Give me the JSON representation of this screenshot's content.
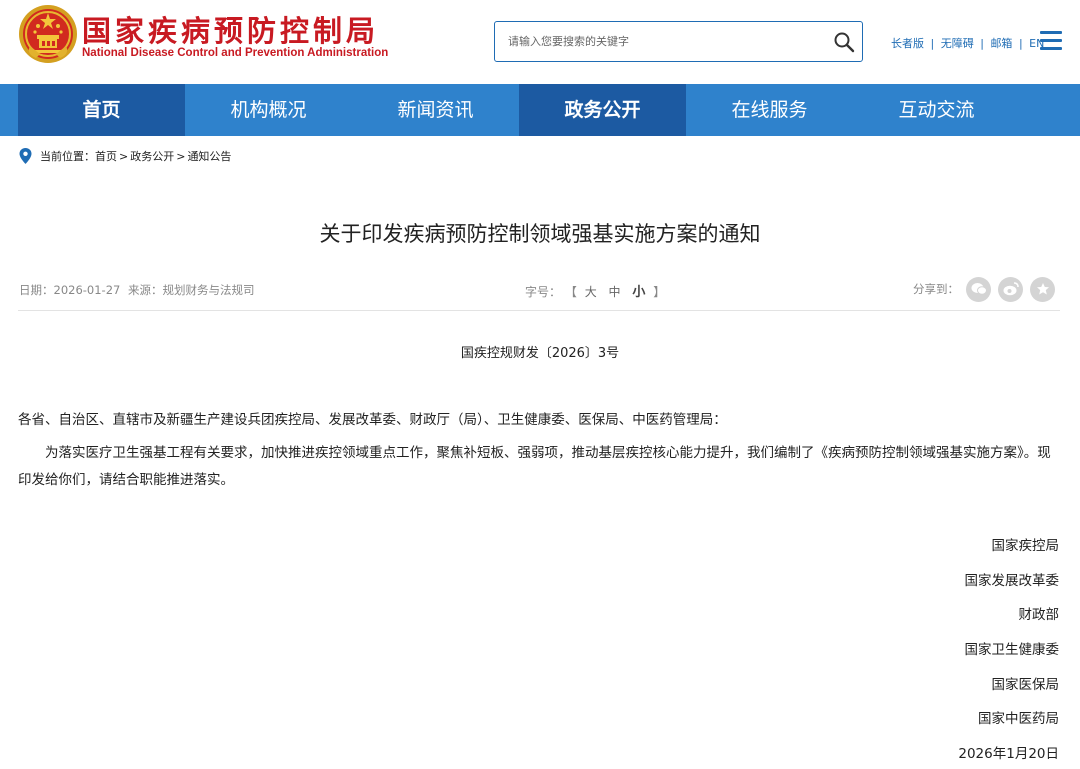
{
  "header": {
    "logo_cn": "国家疾病预防控制局",
    "logo_en": "National Disease Control and Prevention Administration",
    "search_placeholder": "请输入您要搜索的关键字",
    "links": [
      "长者版",
      "无障碍",
      "邮箱",
      "EN"
    ],
    "link_separator": "|"
  },
  "nav": {
    "items": [
      "首页",
      "机构概况",
      "新闻资讯",
      "政务公开",
      "在线服务",
      "互动交流"
    ],
    "highlighted": [
      "首页",
      "政务公开"
    ]
  },
  "breadcrumb": {
    "prefix": "当前位置：",
    "items": [
      "首页",
      "政务公开",
      "通知公告"
    ],
    "separator": ">"
  },
  "article": {
    "title": "关于印发疾病预防控制领域强基实施方案的通知",
    "date_label": "日期：",
    "date": "2026-01-27",
    "source_label": "来源：",
    "source": "规划财务与法规司",
    "font_label": "字号：",
    "font_open": "【",
    "font_large": "大",
    "font_medium": "中",
    "font_small": "小",
    "font_close": "】",
    "share_label": "分享到：",
    "doc_number": "国疾控规财发〔2026〕3号",
    "salutation": "各省、自治区、直辖市及新疆生产建设兵团疾控局、发展改革委、财政厅（局）、卫生健康委、医保局、中医药管理局：",
    "body": "为落实医疗卫生强基工程有关要求，加快推进疾控领域重点工作，聚焦补短板、强弱项，推动基层疾控核心能力提升，我们编制了《疾病预防控制领域强基实施方案》。现印发给你们，请结合职能推进落实。",
    "signers": [
      "国家疾控局",
      "国家发展改革委",
      "财政部",
      "国家卫生健康委",
      "国家医保局",
      "国家中医药局"
    ],
    "sign_date": "2026年1月20日"
  },
  "colors": {
    "brand_red": "#c81a22",
    "nav_blue": "#2f82cc",
    "nav_active": "#1c5aa2",
    "link_blue": "#1f6cb4"
  },
  "icons": [
    "national-emblem",
    "search-icon",
    "menu-icon",
    "location-pin-icon",
    "wechat-icon",
    "weibo-icon",
    "favorite-icon"
  ]
}
